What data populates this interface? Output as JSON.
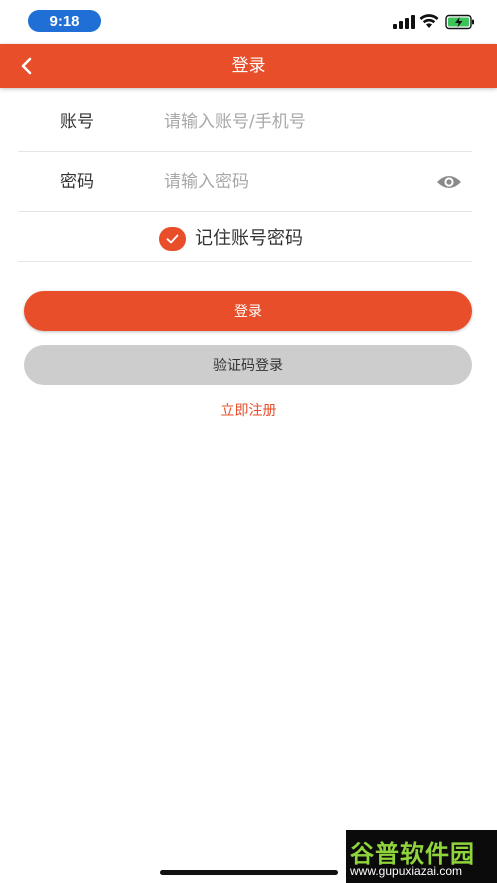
{
  "status_bar": {
    "time": "9:18"
  },
  "nav": {
    "title": "登录"
  },
  "form": {
    "account_label": "账号",
    "account_placeholder": "请输入账号/手机号",
    "password_label": "密码",
    "password_placeholder": "请输入密码",
    "remember_label": "记住账号密码",
    "remember_checked": true
  },
  "buttons": {
    "login": "登录",
    "code_login": "验证码登录",
    "register": "立即注册"
  },
  "watermark": {
    "title": "谷普软件园",
    "url": "www.gupuxiazai.com"
  },
  "colors": {
    "accent": "#e84e2a",
    "secondary_button": "#cdcdcd",
    "time_pill": "#1f6fd6"
  }
}
